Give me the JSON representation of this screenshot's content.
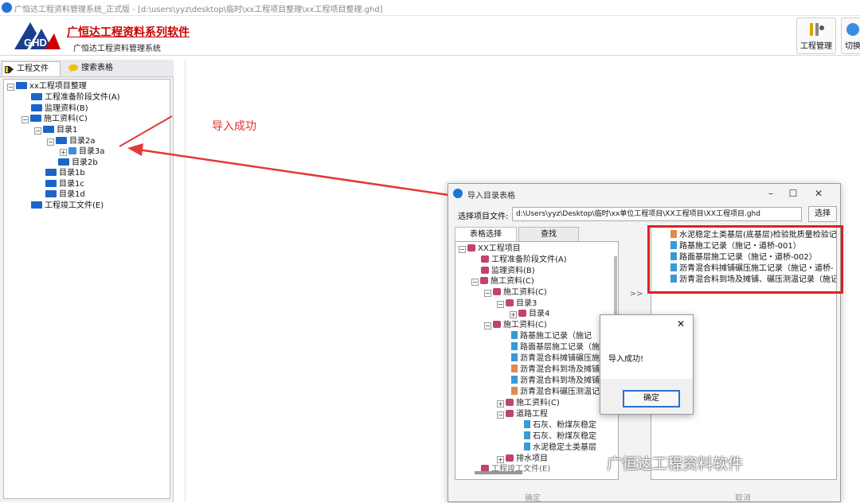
{
  "window": {
    "title": "广恒达工程资料管理系统_正式版 - [d:\\users\\yyz\\desktop\\临时\\xx工程项目整理\\xx工程项目整理.ghd]"
  },
  "header": {
    "brand": "广恒达工程资料系列软件",
    "subtitle": "广恒达工程资料管理系统",
    "buttons": [
      {
        "label": "工程管理",
        "icon": "project-manage-icon"
      },
      {
        "label": "切换",
        "icon": "switch-icon"
      }
    ]
  },
  "left": {
    "tabs": [
      {
        "label": "工程文件",
        "icon": "project-file-icon"
      },
      {
        "label": "搜索表格",
        "icon": "search-table-icon"
      }
    ],
    "tree": [
      "xx工程项目整理",
      "工程准备阶段文件(A)",
      "监理资料(B)",
      "施工资料(C)",
      "目录1",
      "目录2a",
      "目录3a",
      "目录2b",
      "目录1b",
      "目录1c",
      "目录1d",
      "工程竣工文件(E)"
    ]
  },
  "annotation": "导入成功",
  "dialog": {
    "title": "导入目录表格",
    "path_label": "选择项目文件:",
    "path_value": "d:\\Users\\yyz\\Desktop\\临时\\xx单位工程项目\\XX工程项目\\XX工程项目.ghd",
    "pick_button": "选择",
    "tabs": [
      "表格选择",
      "查找"
    ],
    "tree": [
      "XX工程项目",
      "工程准备阶段文件(A)",
      "监理资料(B)",
      "施工资料(C)",
      "施工资料(C)",
      "目录3",
      "目录4",
      "施工资料(C)",
      "路基施工记录（施记",
      "路面基层施工记录（施",
      "沥青混合料摊铺碾压施",
      "沥青混合料到场及摊铺",
      "沥青混合料到场及摊铺",
      "沥青混合料碾压测温记",
      "施工资料(C)",
      "道路工程",
      "石灰、粉煤灰稳定",
      "石灰、粉煤灰稳定",
      "水泥稳定土类基层",
      "排水项目",
      "工程竣工文件(E)"
    ],
    "move_button": ">>",
    "right_list": [
      "水泥稳定土类基层(底基层)检验批质量检验记",
      "路基施工记录（施记・道桥-001）",
      "路面基层施工记录（施记・道桥-002）",
      "沥青混合料摊铺碾压施工记录（施记・道桥-",
      "沥青混合料到场及摊铺、碾压测温记录（施记"
    ],
    "ok": "确定",
    "cancel": "取消"
  },
  "message": {
    "text": "导入成功!",
    "ok": "确定"
  },
  "watermark": "广恒达工程资料软件",
  "colors": {
    "highlight": "#e02020",
    "brand": "#cc0000",
    "folder": "#1d64c8"
  }
}
